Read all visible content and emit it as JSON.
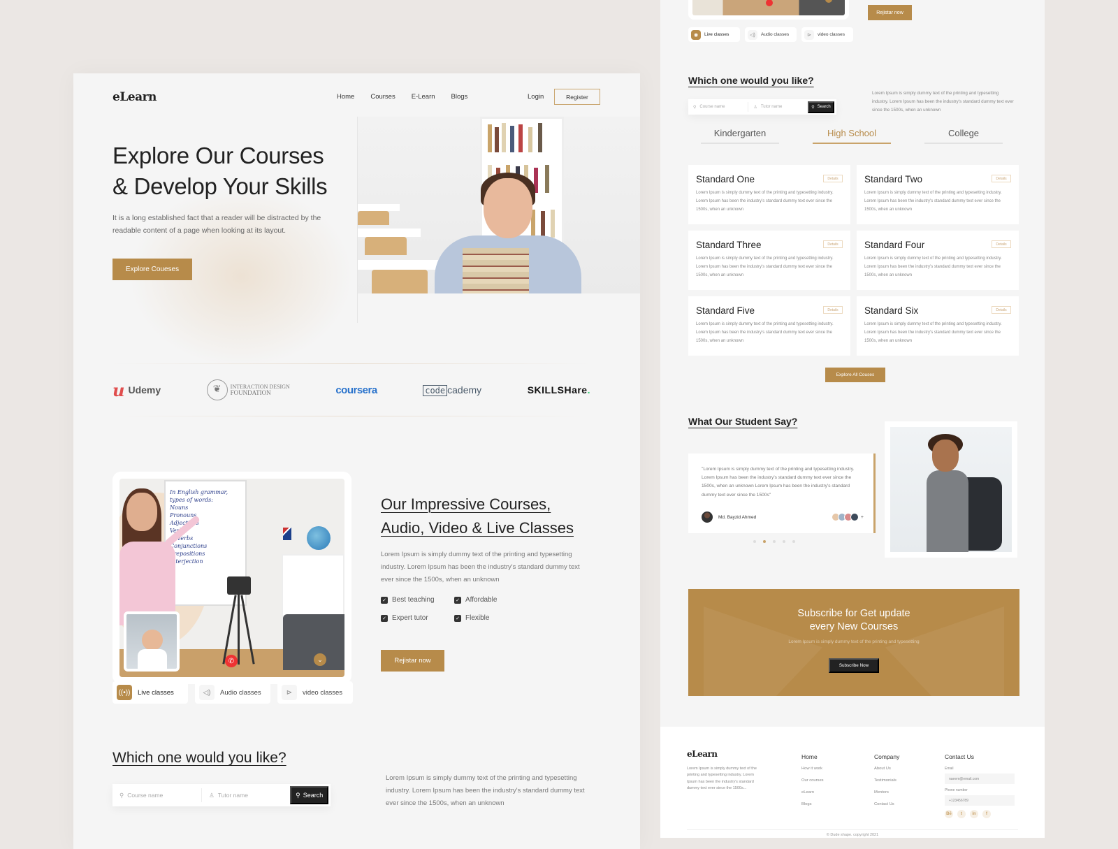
{
  "brand": {
    "logo": "eLearn",
    "accent": "#b78b4a"
  },
  "nav": {
    "items": [
      "Home",
      "Courses",
      "E-Learn",
      "Blogs"
    ],
    "login": "Login",
    "register": "Register"
  },
  "hero": {
    "title_line1": "Explore Our Courses",
    "title_line2": "& Develop Your Skills",
    "description": "It is a long established fact that a reader will be distracted by the readable content of a page when looking at its layout.",
    "button": "Explore Coueses"
  },
  "partners": {
    "udemy": "Udemy",
    "idf_line1": "INTERACTION DESIGN",
    "idf_line2": "FOUNDATION",
    "coursera": "coursera",
    "codecademy_box": "code",
    "codecademy_rest": "cademy",
    "skillshare": "SKILLSHare",
    "skillshare_dot": "."
  },
  "classes": {
    "board_lines": [
      "In English grammar,",
      "types of words:",
      "Nouns",
      "Pronouns",
      "Adjectives",
      "Verbs",
      "Adverbs",
      "Conjunctions",
      "Prepositions",
      "Interjection"
    ],
    "tabs": [
      {
        "label": "Live classes",
        "icon": "live-icon",
        "glyph": "((•))",
        "active": true
      },
      {
        "label": "Audio classes",
        "icon": "speaker-icon",
        "glyph": "🔈",
        "active": false
      },
      {
        "label": "video classes",
        "icon": "play-icon",
        "glyph": "▷",
        "active": false
      }
    ]
  },
  "courses": {
    "title_line1": "Our Impressive Courses,",
    "title_line2": "Audio, Video & Live Classes",
    "description": "Lorem Ipsum is simply dummy text of the printing and typesetting industry. Lorem Ipsum has been the industry's standard dummy text ever since the 1500s, when an unknown",
    "features": [
      "Best teaching",
      "Affordable",
      "Expert tutor",
      "Flexible"
    ],
    "button": "Rejistar now"
  },
  "which": {
    "title": "Which one would you like?",
    "course_placeholder": "Course name",
    "tutor_placeholder": "Tutor name",
    "search_button": "Search",
    "description": "Lorem Ipsum is simply dummy text of the printing and typesetting industry. Lorem Ipsum has been the industry's standard dummy text ever since the 1500s, when an unknown"
  },
  "levels": {
    "tabs": [
      "Kindergarten",
      "High School",
      "College"
    ],
    "active": "High School"
  },
  "standards": [
    {
      "title": "Standard One",
      "details": "Details",
      "text": "Lorem Ipsum is simply dummy text of the printing and typesetting industry. Lorem Ipsum has been the industry's standard dummy text ever since the 1500s, when an unknown"
    },
    {
      "title": "Standard Two",
      "details": "Details",
      "text": "Lorem Ipsum is simply dummy text of the printing and typesetting industry. Lorem Ipsum has been the industry's standard dummy text ever since the 1500s, when an unknown"
    },
    {
      "title": "Standard Three",
      "details": "Details",
      "text": "Lorem Ipsum is simply dummy text of the printing and typesetting industry. Lorem Ipsum has been the industry's standard dummy text ever since the 1500s, when an unknown"
    },
    {
      "title": "Standard Four",
      "details": "Details",
      "text": "Lorem Ipsum is simply dummy text of the printing and typesetting industry. Lorem Ipsum has been the industry's standard dummy text ever since the 1500s, when an unknown"
    },
    {
      "title": "Standard Five",
      "details": "Details",
      "text": "Lorem Ipsum is simply dummy text of the printing and typesetting industry. Lorem Ipsum has been the industry's standard dummy text ever since the 1500s, when an unknown"
    },
    {
      "title": "Standard Six",
      "details": "Details",
      "text": "Lorem Ipsum is simply dummy text of the printing and typesetting industry. Lorem Ipsum has been the industry's standard dummy text ever since the 1500s, when an unknown"
    }
  ],
  "explore_all": "Explore All Couses",
  "testimonials": {
    "title": "What Our Student Say?",
    "quote": "\"Lorem Ipsum is simply dummy text of the printing and typesetting industry. Lorem Ipsum has been the industry's standard dummy text ever since the 1500s, when an unknown Lorem Ipsum has been the industry's standard dummy text ever since the 1500s\"",
    "author": "Md. Bayzid Ahmed",
    "more": "+",
    "slides": 5,
    "active_slide": 2
  },
  "subscribe": {
    "title_line1": "Subscribe for Get update",
    "title_line2": "every New Courses",
    "subtitle": "Lorem Ipsum is simply dummy text of the printing and typesetting",
    "button": "Subscribe Now"
  },
  "footer": {
    "logo": "eLearn",
    "description": "Lorem Ipsum is simply dummy text of the printing and typesetting industry. Lorem Ipsum has been the industry's standard dummy text ever since the 1500s...",
    "col1": {
      "title": "Home",
      "links": [
        "How it work",
        "Our courses",
        "eLearn",
        "Blogs"
      ]
    },
    "col2": {
      "title": "Company",
      "links": [
        "About Us",
        "Testimonials",
        "Mentors",
        "Contact Us"
      ]
    },
    "contact": {
      "title": "Contact Us",
      "email_label": "Email",
      "email_value": "naeem@email.com",
      "phone_label": "Phone number",
      "phone_value": "+123456789",
      "socials": [
        {
          "name": "behance-icon",
          "glyph": "Bē"
        },
        {
          "name": "twitter-icon",
          "glyph": "t"
        },
        {
          "name": "linkedin-icon",
          "glyph": "in"
        },
        {
          "name": "facebook-icon",
          "glyph": "f"
        }
      ]
    },
    "copyright": "© Dude shape. copyright 2021"
  }
}
